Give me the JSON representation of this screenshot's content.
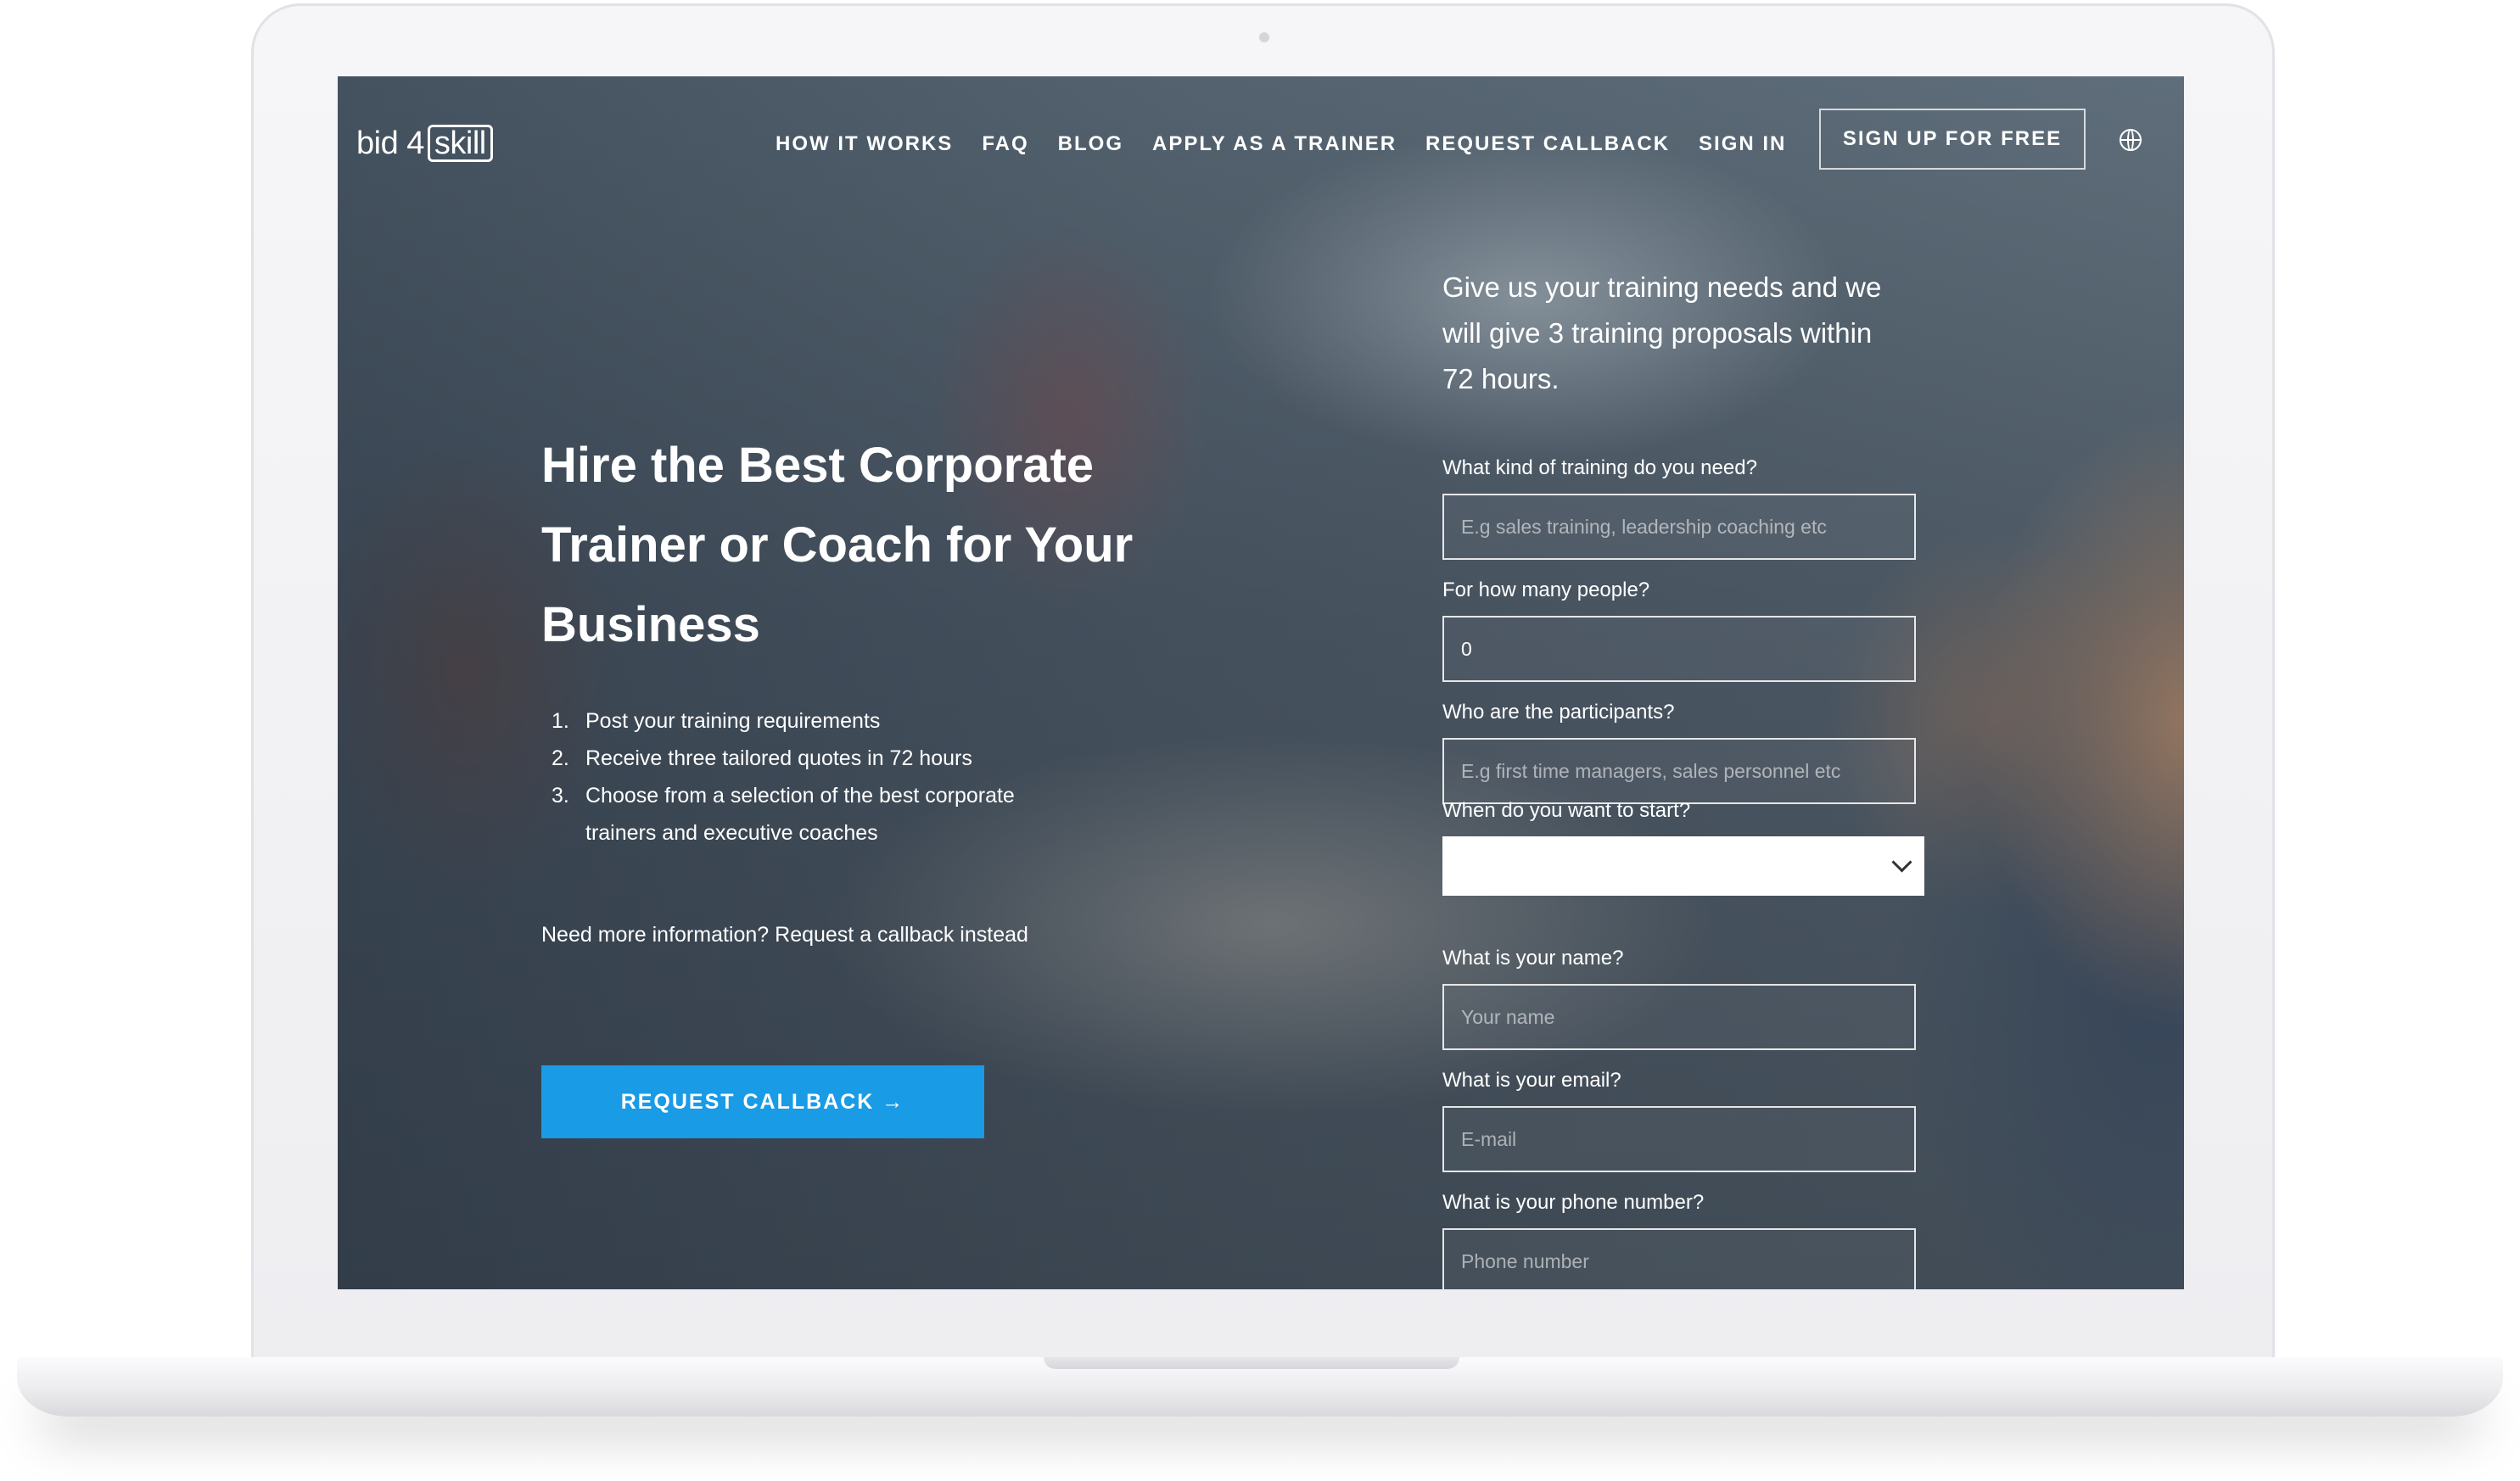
{
  "nav": {
    "logo_text": "bid 4",
    "logo_badge": "skill",
    "items": [
      {
        "label": "HOW IT WORKS"
      },
      {
        "label": "FAQ"
      },
      {
        "label": "BLOG"
      },
      {
        "label": "APPLY AS A TRAINER"
      },
      {
        "label": "REQUEST CALLBACK"
      },
      {
        "label": "SIGN IN"
      }
    ],
    "signup_label": "SIGN UP FOR FREE",
    "language_icon": "globe-icon"
  },
  "hero": {
    "headline": "Hire the Best Corporate Trainer or Coach for Your Business",
    "steps": [
      {
        "num": "1.",
        "text": "Post your training requirements"
      },
      {
        "num": "2.",
        "text": "Receive three tailored quotes in 72 hours"
      },
      {
        "num": "3.",
        "text": "Choose from a selection of the best corporate trainers and executive coaches"
      }
    ],
    "more_info": "Need more information? Request a callback instead",
    "cta_label": "REQUEST CALLBACK →"
  },
  "form": {
    "intro": "Give us your training needs and we will give 3 training proposals within 72 hours.",
    "training": {
      "label": "What kind of training do you need?",
      "placeholder": "E.g sales training, leadership coaching etc"
    },
    "people": {
      "label": "For how many people?",
      "value": "0"
    },
    "participants": {
      "label": "Who are the participants?",
      "placeholder": "E.g first time managers, sales personnel etc"
    },
    "start": {
      "label": "When do you want to start?",
      "value": ""
    },
    "name": {
      "label": "What is your name?",
      "placeholder": "Your name"
    },
    "email": {
      "label": "What is your email?",
      "placeholder": "E-mail"
    },
    "phone": {
      "label": "What is your phone number?",
      "placeholder": "Phone number"
    }
  },
  "colors": {
    "accent": "#1a9be6",
    "text": "#ffffff"
  }
}
